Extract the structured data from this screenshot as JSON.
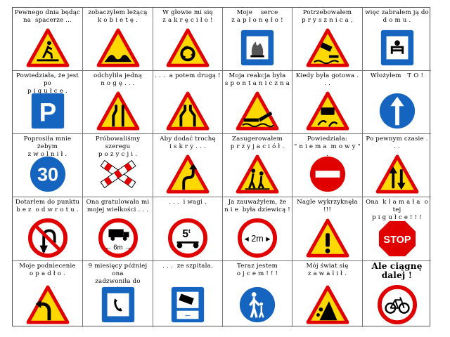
{
  "cells": [
    {
      "text": "Pewnego dnia będąc\nna  spacerze ...",
      "sign": "pedestrian-warning-sign"
    },
    {
      "text": "zobaczyłem leżącą\nk o b i e t ę .",
      "sign": "bumpy-road-sign"
    },
    {
      "text": "W głowie mi się\nz a k r ę c i ł o !",
      "sign": "roundabout-warning-sign"
    },
    {
      "text": "Moje    serce\nz a p ł o n ę ł o !",
      "sign": "fire-extinguisher-sign"
    },
    {
      "text": "Potrzebowałem\np r y s z n i c a ,",
      "sign": "car-into-water-sign"
    },
    {
      "text": "więc zabrałem ją do\nd o m u .",
      "sign": "hotel-sign"
    },
    {
      "text": "Powiedziała, że jest po\np i g u ł c e .",
      "sign": "parking-sign"
    },
    {
      "text": "odchyliła jedną\nn o g ę . . .",
      "sign": "road-narrows-right-sign"
    },
    {
      "text": ". . .  a potem drugą !",
      "sign": "road-narrows-both-sign"
    },
    {
      "text": "Moja reakcja była\ns p o n t a n i c z n a .",
      "sign": "drawbridge-sign"
    },
    {
      "text": "Kiedy była gotowa . . .",
      "sign": "slippery-road-sign"
    },
    {
      "text": "Włożyłem   T O !",
      "sign": "ahead-only-sign"
    },
    {
      "text": "Poprosiła mnie żebym\nz w o l n i ł .",
      "sign": "minimum-speed-30-sign"
    },
    {
      "text": "Próbowaliśmy szeregu\np o z y c j i .",
      "sign": "railway-crossing-sign"
    },
    {
      "text": "Aby dodać trochę\ni s k r y . . .",
      "sign": "double-bend-sign"
    },
    {
      "text": "Zasugerowałem\np r z y j a c i ó ł .",
      "sign": "children-crossing-sign"
    },
    {
      "text": "Powiedziała:\n\" n i e m a  m o w y \" .",
      "sign": "no-entry-sign"
    },
    {
      "text": "Po pewnym czasie . . .",
      "sign": "two-way-traffic-sign"
    },
    {
      "text": "Dotarłem do punktu\nb e z  o d w r o t u .",
      "sign": "no-u-turn-sign"
    },
    {
      "text": "Ona gratulowała mi\nmojej wielkości . . .",
      "sign": "vehicle-length-limit-sign"
    },
    {
      "text": ". . .  i wagi .",
      "sign": "axle-weight-limit-sign"
    },
    {
      "text": "Ja zauważyłem, że\nn i e  była dziewicą !",
      "sign": "width-limit-sign"
    },
    {
      "text": "Nagle wykrzyknęła !!!",
      "sign": "danger-sign"
    },
    {
      "text": "Ona  k ł a m a ł a  o tej\np i g u ł c e ! ! !",
      "sign": "stop-sign"
    },
    {
      "text": "Moje podniecenie\no p a d ł o .",
      "sign": "curve-left-sign"
    },
    {
      "text": "9 miesięcy później ona\nzadzwoniła do mnie...",
      "sign": "telephone-sign"
    },
    {
      "text": ". . .  ze szpitala.",
      "sign": "ambulance-sign"
    },
    {
      "text": "Teraz jestem\no j c e m ! ! !",
      "sign": "pedestrian-path-sign"
    },
    {
      "text": "Mój świat się\nz a w a l i ł .",
      "sign": "falling-rocks-sign"
    },
    {
      "text": "Ale ciągnę dalej !",
      "sign": "no-bicycles-sign",
      "bold": true
    }
  ],
  "units": {
    "axle_t": "5",
    "axle_unit": "t",
    "width_m": "2",
    "width_unit": "m",
    "length_m": "6",
    "length_unit": "m",
    "speed": "30",
    "stop": "STOP"
  },
  "colors": {
    "warning_fill": "#ffd800",
    "red": "#e00000",
    "blue": "#1565c0",
    "black": "#000000"
  }
}
